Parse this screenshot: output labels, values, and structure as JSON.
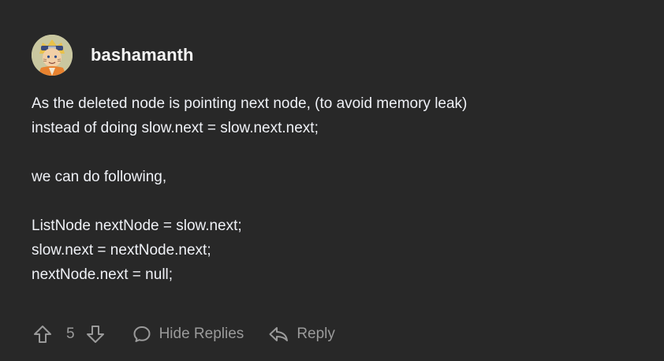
{
  "comment": {
    "author": "bashamanth",
    "avatar_icon": "user-avatar-icon",
    "paragraphs": [
      [
        "As the deleted node is pointing next node, (to avoid memory leak)",
        "instead of doing slow.next = slow.next.next;"
      ],
      [
        "we can do following,"
      ],
      [
        "ListNode nextNode = slow.next;",
        "slow.next = nextNode.next;",
        "nextNode.next = null;"
      ]
    ]
  },
  "actions": {
    "upvote_icon": "arrow-up-icon",
    "vote_count": "5",
    "downvote_icon": "arrow-down-icon",
    "hide_replies_icon": "speech-bubble-icon",
    "hide_replies_label": "Hide Replies",
    "reply_icon": "reply-arrow-icon",
    "reply_label": "Reply"
  },
  "colors": {
    "background": "#282828",
    "text": "#eff1f6",
    "muted": "#9a9a9a"
  }
}
